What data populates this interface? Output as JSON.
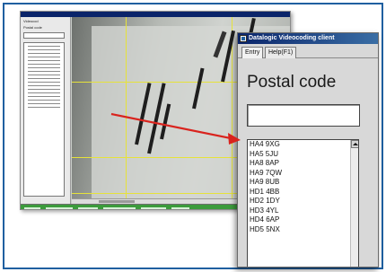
{
  "background_app": {
    "panel_header": "Videocod",
    "field_label": "Postal code"
  },
  "dialog": {
    "title": "Datalogic Videocoding client",
    "tabs": [
      "Entry",
      "Help(F1)"
    ],
    "postal_label": "Postal code",
    "postal_value": "",
    "postcodes": [
      "HA4 9XG",
      "HA5 5JU",
      "HA8 8AP",
      "HA9 7QW",
      "HA9 8UB",
      "HD1 4BB",
      "HD2 1DY",
      "HD3 4YL",
      "HD4 6AP",
      "HD5 5NX"
    ]
  },
  "colors": {
    "frame": "#1f5fa0",
    "arrow": "#d9231d",
    "titlebar": "#0a246a",
    "statusbar": "#3c9b3c",
    "gridlines": "#e6e23a"
  }
}
